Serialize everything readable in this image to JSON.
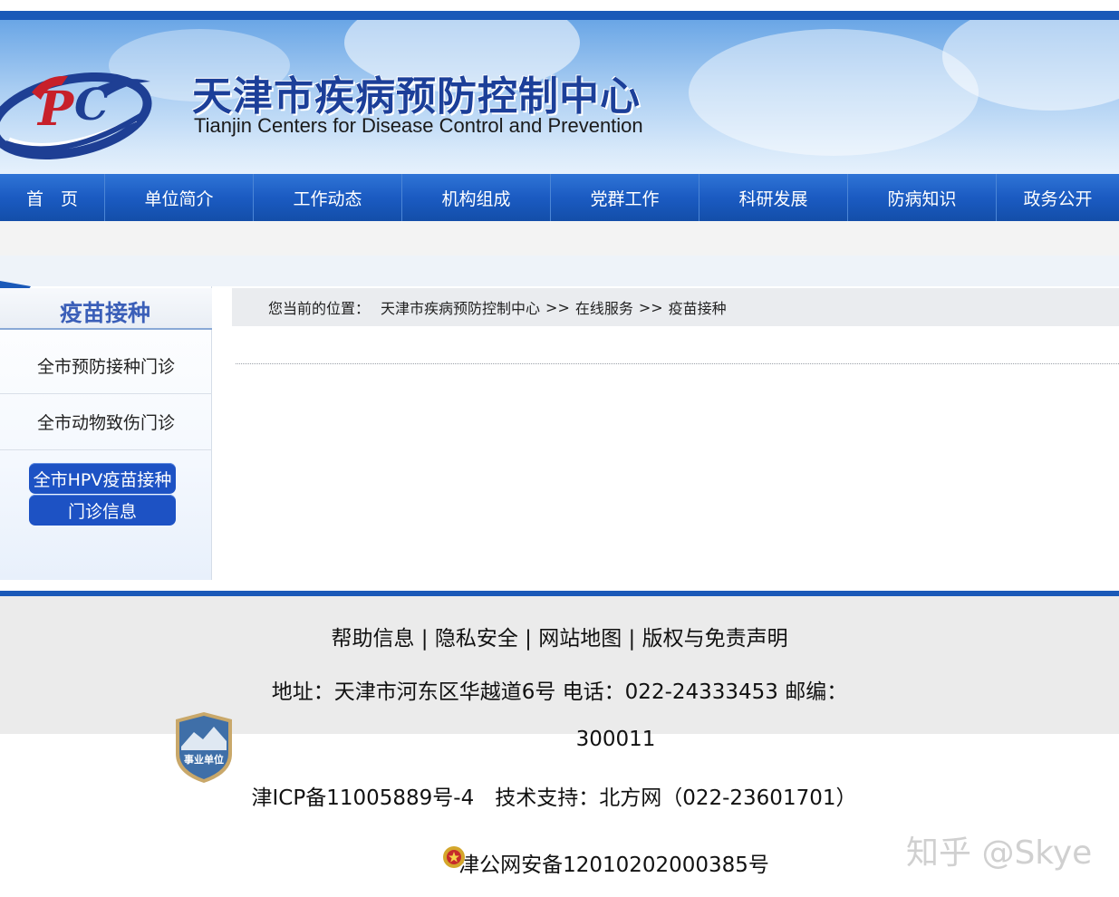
{
  "header": {
    "title": "天津市疾病预防控制中心",
    "subtitle": "Tianjin Centers for Disease Control and Prevention",
    "logo_icon": "cdc-logo",
    "brand_color": "#1a59b8"
  },
  "nav": {
    "items": [
      {
        "label": "首　页"
      },
      {
        "label": "单位简介"
      },
      {
        "label": "工作动态"
      },
      {
        "label": "机构组成"
      },
      {
        "label": "党群工作"
      },
      {
        "label": "科研发展"
      },
      {
        "label": "防病知识"
      },
      {
        "label": "政务公开"
      }
    ]
  },
  "sidebar": {
    "title": "疫苗接种",
    "items": [
      {
        "label": "全市预防接种门诊"
      },
      {
        "label": "全市动物致伤门诊"
      }
    ],
    "active_item": {
      "line1": "全市HPV疫苗接种",
      "line2": "门诊信息"
    }
  },
  "breadcrumb": {
    "prefix": "您当前的位置：",
    "items": [
      "天津市疾病预防控制中心",
      "在线服务",
      "疫苗接种"
    ],
    "separator": ">>"
  },
  "footer": {
    "links": [
      "帮助信息",
      "隐私安全",
      "网站地图",
      "版权与免责声明"
    ],
    "link_separator": "|",
    "address_line": "地址：天津市河东区华越道6号 电话：022-24333453 邮编：",
    "postcode": "300011",
    "icp_line": "津ICP备11005889号-4　技术支持：北方网（022-23601701）",
    "police_record": "津公网安备12010202000385号",
    "badge_text": "事业单位",
    "badge_icon": "public-institution-badge",
    "police_icon": "police-emblem-icon"
  },
  "watermark": "知乎 @Skye"
}
